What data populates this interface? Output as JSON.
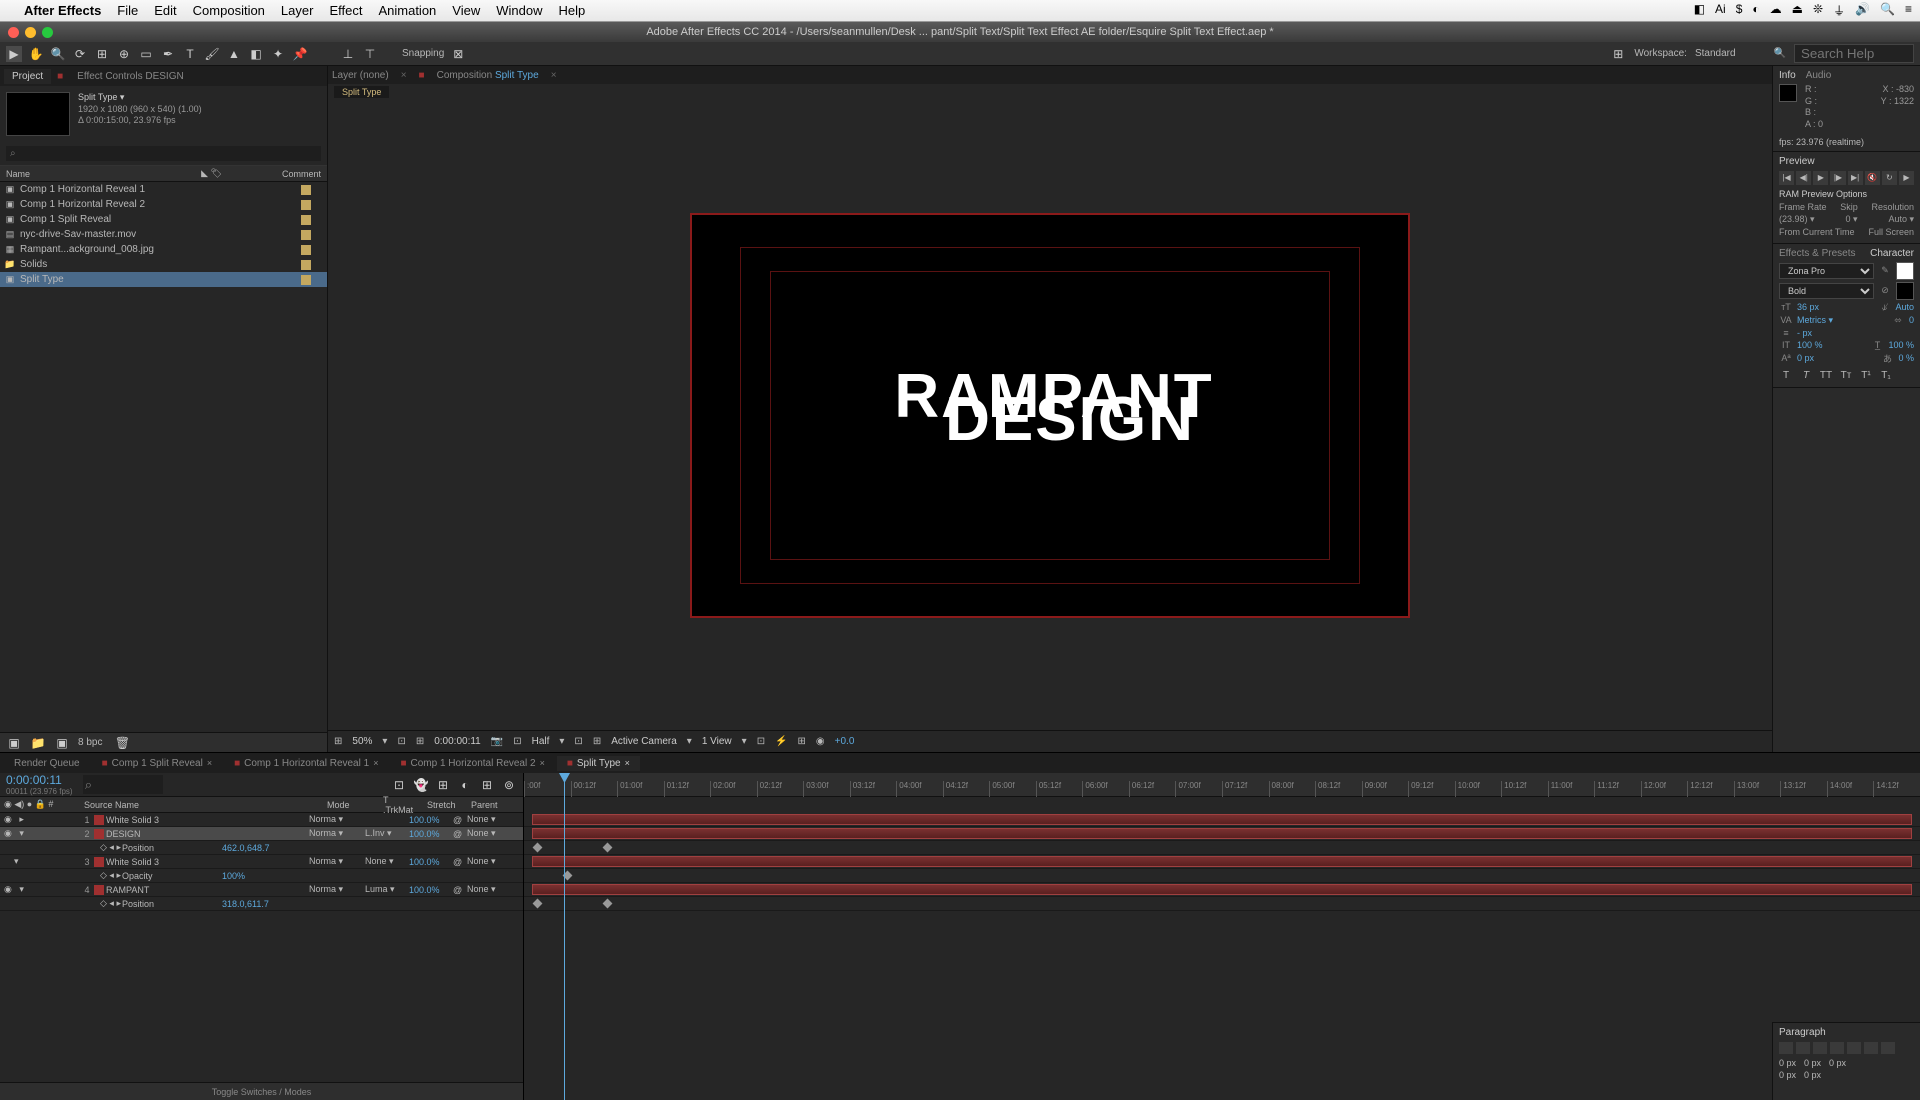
{
  "menubar": {
    "app": "After Effects",
    "items": [
      "File",
      "Edit",
      "Composition",
      "Layer",
      "Effect",
      "Animation",
      "View",
      "Window",
      "Help"
    ]
  },
  "window_title": "Adobe After Effects CC 2014 - /Users/seanmullen/Desk ... pant/Split Text/Split Text Effect AE folder/Esquire Split Text Effect.aep *",
  "toolbar": {
    "snapping": "Snapping"
  },
  "workspace": {
    "label": "Workspace:",
    "value": "Standard",
    "search_ph": "Search Help"
  },
  "project": {
    "tab1": "Project",
    "tab2": "Effect Controls DESIGN",
    "comp_name": "Split Type ▾",
    "dims": "1920 x 1080 (960 x 540) (1.00)",
    "dur": "Δ 0:00:15:00, 23.976 fps",
    "col_name": "Name",
    "col_comment": "Comment",
    "items": [
      "Comp 1 Horizontal Reveal 1",
      "Comp 1 Horizontal Reveal 2",
      "Comp 1 Split Reveal",
      "nyc-drive-Sav-master.mov",
      "Rampant...ackground_008.jpg",
      "Solids",
      "Split Type"
    ],
    "bpc": "8 bpc"
  },
  "comp": {
    "layer_tab": "Layer (none)",
    "comp_tab_pre": "Composition ",
    "comp_tab_name": "Split Type",
    "sub_tab": "Split Type",
    "text1": "RAMPANT",
    "text2": "DESIGN"
  },
  "viewer_footer": {
    "mag": "50%",
    "time": "0:00:00:11",
    "res": "Half",
    "camera": "Active Camera",
    "views": "1 View",
    "exp": "+0.0"
  },
  "info": {
    "tab1": "Info",
    "tab2": "Audio",
    "R": "R :",
    "G": "G :",
    "B": "B :",
    "A": "A : 0",
    "X": "X : -830",
    "Y": "Y :  1322",
    "fps": "fps: 23.976 (realtime)"
  },
  "preview": {
    "title": "Preview",
    "ram_title": "RAM Preview Options",
    "fr_l": "Frame Rate",
    "sk_l": "Skip",
    "res_l": "Resolution",
    "fr_v": "(23.98) ▾",
    "sk_v": "0    ▾",
    "res_v": "Auto    ▾",
    "from": "From Current Time",
    "full": "Full Screen"
  },
  "effects_presets": "Effects & Presets",
  "character": {
    "title": "Character",
    "font": "Zona Pro",
    "style": "Bold",
    "size": "36 px",
    "leading": "Auto",
    "kerning": "Metrics ▾",
    "tracking": "0",
    "stroke": "- px",
    "vscale": "100 %",
    "hscale": "100 %",
    "baseline": "0 px",
    "tsume": "0 %"
  },
  "timeline": {
    "tabs": [
      "Render Queue",
      "Comp 1 Split Reveal",
      "Comp 1 Horizontal Reveal 1",
      "Comp 1 Horizontal Reveal 2",
      "Split Type"
    ],
    "timecode": "0:00:00:11",
    "timecode_sub": "00011 (23.976 fps)",
    "col_src": "Source Name",
    "col_mode": "Mode",
    "col_trk": "T .TrkMat",
    "col_str": "Stretch",
    "col_par": "Parent",
    "layers": [
      {
        "n": "1",
        "name": "White Solid 3",
        "mode": "Norma ▾",
        "trk": "",
        "str": "100.0%",
        "par": "None ▾"
      },
      {
        "n": "2",
        "name": "DESIGN",
        "mode": "Norma ▾",
        "trk": "L.Inv ▾",
        "str": "100.0%",
        "par": "None ▾",
        "sel": true
      },
      {
        "n": "",
        "name": "Position",
        "pval": "462.0,648.7",
        "prop": true
      },
      {
        "n": "3",
        "name": "White Solid 3",
        "mode": "Norma ▾",
        "trk": "None ▾",
        "str": "100.0%",
        "par": "None ▾"
      },
      {
        "n": "",
        "name": "Opacity",
        "pval": "100%",
        "prop": true
      },
      {
        "n": "4",
        "name": "RAMPANT",
        "mode": "Norma ▾",
        "trk": "Luma ▾",
        "str": "100.0%",
        "par": "None ▾"
      },
      {
        "n": "",
        "name": "Position",
        "pval": "318.0,611.7",
        "prop": true
      }
    ],
    "ruler": [
      ":00f",
      "00:12f",
      "01:00f",
      "01:12f",
      "02:00f",
      "02:12f",
      "03:00f",
      "03:12f",
      "04:00f",
      "04:12f",
      "05:00f",
      "05:12f",
      "06:00f",
      "06:12f",
      "07:00f",
      "07:12f",
      "08:00f",
      "08:12f",
      "09:00f",
      "09:12f",
      "10:00f",
      "10:12f",
      "11:00f",
      "11:12f",
      "12:00f",
      "12:12f",
      "13:00f",
      "13:12f",
      "14:00f",
      "14:12f"
    ],
    "toggle": "Toggle Switches / Modes"
  },
  "paragraph": {
    "title": "Paragraph",
    "indents": [
      "0 px",
      "0 px",
      "0 px"
    ],
    "spacing": [
      "0 px",
      "0 px"
    ]
  }
}
